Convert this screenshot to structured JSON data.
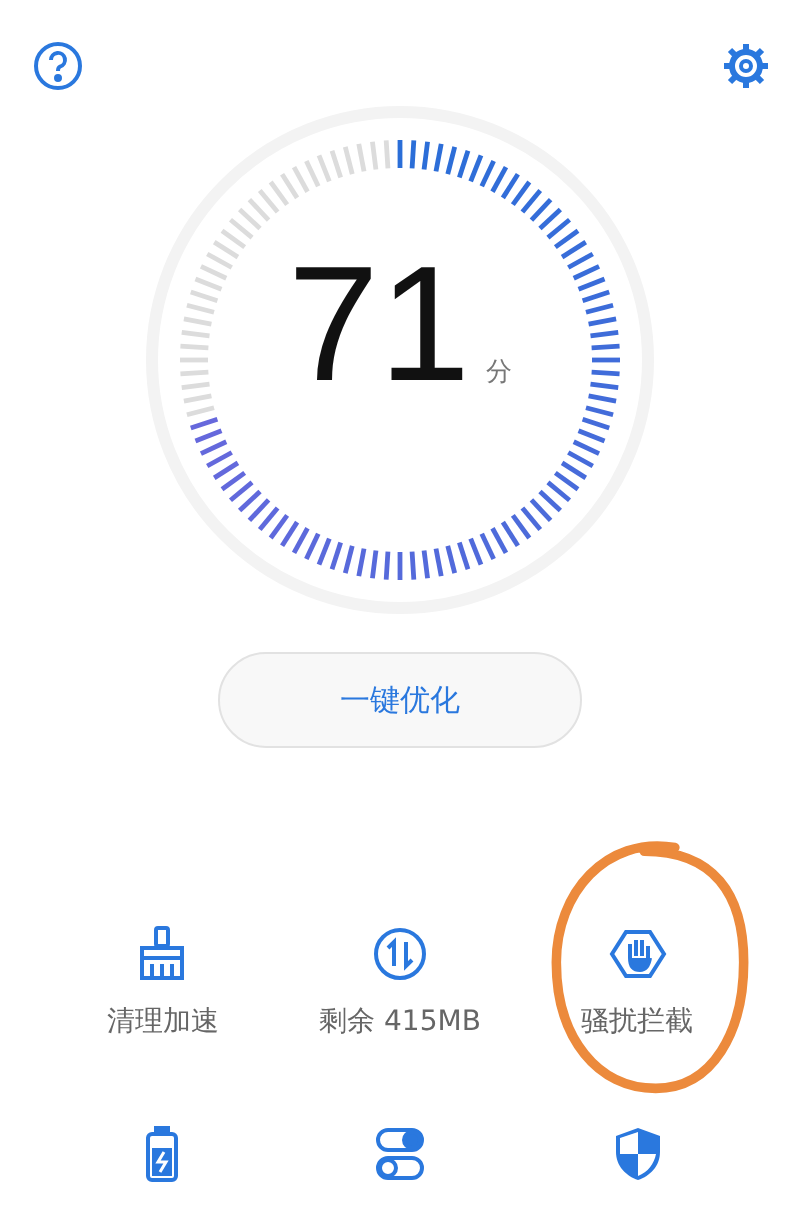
{
  "gauge": {
    "score": "71",
    "unit": "分",
    "level": 0.71
  },
  "optimize_button": {
    "label": "一键优化"
  },
  "tools": [
    {
      "kind": "broom",
      "label": "清理加速"
    },
    {
      "kind": "swap",
      "label": "剩余 415MB"
    },
    {
      "kind": "hand",
      "label": "骚扰拦截"
    },
    {
      "kind": "battery"
    },
    {
      "kind": "toggles"
    },
    {
      "kind": "shield"
    }
  ]
}
